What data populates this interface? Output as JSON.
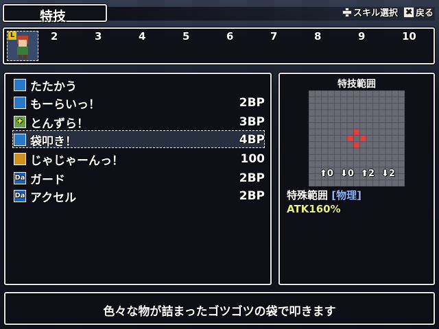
{
  "header": {
    "title": "特技",
    "hint_select": "スキル選択",
    "hint_back": "戻る"
  },
  "party": {
    "current_level_badge": "L",
    "slots": [
      "2",
      "3",
      "4",
      "5",
      "6",
      "7",
      "8",
      "9",
      "10"
    ]
  },
  "skills": [
    {
      "icon": "sword-icon",
      "icon_text": "",
      "name": "たたかう",
      "cost": ""
    },
    {
      "icon": "square-skill-icon",
      "icon_text": "",
      "name": "もーらいっ！",
      "cost": "2BP"
    },
    {
      "icon": "plus-skill-icon",
      "icon_text": "✚",
      "name": "とんずら！",
      "cost": "3BP"
    },
    {
      "icon": "square-skill-icon",
      "icon_text": "",
      "name": "袋叩き！",
      "cost": "4BP"
    },
    {
      "icon": "dice-skill-icon",
      "icon_text": "",
      "name": "じゃじゃーんっ！",
      "cost": "100"
    },
    {
      "icon": "da-skill-icon",
      "icon_text": "Da",
      "name": "ガード",
      "cost": "2BP"
    },
    {
      "icon": "da-skill-icon",
      "icon_text": "Da",
      "name": "アクセル",
      "cost": "2BP"
    }
  ],
  "selected_index": 3,
  "range": {
    "title": "特技範囲",
    "legend": [
      "0",
      "0",
      "2",
      "2"
    ],
    "range_type_label": "特殊範囲",
    "range_type_value": "[物理]",
    "atk": "ATK160%"
  },
  "colors": {
    "window_border": "#e8e8e8",
    "atk_text": "#e8f080",
    "highlight": "#e04040"
  },
  "description": "色々な物が詰まったゴツゴツの袋で叩きます"
}
